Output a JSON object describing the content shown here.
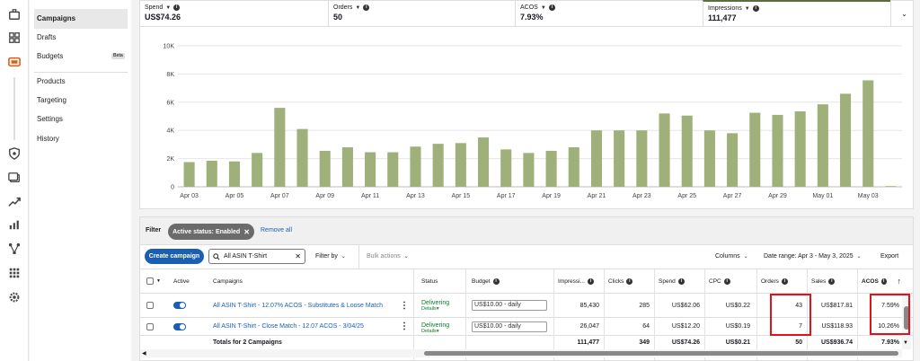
{
  "sidebar_rail": {
    "icons": [
      "briefcase-icon",
      "dashboard-icon",
      "campaign-manager-icon",
      "shield-icon",
      "media-icon",
      "growth-icon",
      "reports-icon",
      "network-icon",
      "apps-grid-icon",
      "settings-icon"
    ],
    "accent": "#e8590c"
  },
  "sidenav": {
    "items": [
      {
        "label": "Campaigns",
        "active": true
      },
      {
        "label": "Drafts"
      },
      {
        "label": "Budgets",
        "badge": "Beta"
      },
      {
        "label": "Products"
      },
      {
        "label": "Targeting"
      },
      {
        "label": "Settings"
      },
      {
        "label": "History"
      }
    ]
  },
  "metrics": [
    {
      "label": "Spend",
      "value": "US$74.26"
    },
    {
      "label": "Orders",
      "value": "50"
    },
    {
      "label": "ACOS",
      "value": "7.93%"
    },
    {
      "label": "Impressions",
      "value": "111,477",
      "selected": true
    }
  ],
  "chart_data": {
    "type": "bar",
    "color": "#9fb07a",
    "ylim": [
      0,
      10000
    ],
    "y_ticks": [
      0,
      2000,
      4000,
      6000,
      8000,
      10000
    ],
    "y_tick_labels": [
      "0",
      "2K",
      "4K",
      "6K",
      "8K",
      "10K"
    ],
    "categories": [
      "Apr 03",
      "Apr 04",
      "Apr 05",
      "Apr 06",
      "Apr 07",
      "Apr 08",
      "Apr 09",
      "Apr 10",
      "Apr 11",
      "Apr 12",
      "Apr 13",
      "Apr 14",
      "Apr 15",
      "Apr 16",
      "Apr 17",
      "Apr 18",
      "Apr 19",
      "Apr 20",
      "Apr 21",
      "Apr 22",
      "Apr 23",
      "Apr 24",
      "Apr 25",
      "Apr 26",
      "Apr 27",
      "Apr 28",
      "Apr 29",
      "Apr 30",
      "May 01",
      "May 02",
      "May 03"
    ],
    "x_tick_labels": [
      "Apr 03",
      "",
      "Apr 05",
      "",
      "Apr 07",
      "",
      "Apr 09",
      "",
      "Apr 11",
      "",
      "Apr 13",
      "",
      "Apr 15",
      "",
      "Apr 17",
      "",
      "Apr 19",
      "",
      "Apr 21",
      "",
      "Apr 23",
      "",
      "Apr 25",
      "",
      "Apr 27",
      "",
      "Apr 29",
      "",
      "May 01",
      "",
      "May 03"
    ],
    "values": [
      1750,
      1850,
      1800,
      2400,
      5600,
      4100,
      2550,
      2800,
      2450,
      2450,
      2850,
      3050,
      3100,
      3500,
      2650,
      2400,
      2550,
      2800,
      4000,
      4000,
      4000,
      5200,
      5050,
      4000,
      3800,
      5250,
      5100,
      5350,
      5850,
      6600,
      7550,
      50
    ],
    "grid": true
  },
  "filter": {
    "label": "Filter",
    "chip": "Active status: Enabled",
    "remove_all": "Remove all"
  },
  "toolbar": {
    "create": "Create campaign",
    "search_value": "All ASIN T-Shirt",
    "filter_by": "Filter by",
    "bulk_actions": "Bulk actions",
    "columns": "Columns",
    "date_range": "Date range: Apr 3 - May 3, 2025",
    "export": "Export"
  },
  "table": {
    "headers": {
      "active": "Active",
      "campaigns": "Campaigns",
      "status": "Status",
      "budget": "Budget",
      "impressions": "Impressi...",
      "clicks": "Clicks",
      "spend": "Spend",
      "cpc": "CPC",
      "orders": "Orders",
      "sales": "Sales",
      "acos": "ACOS"
    },
    "rows": [
      {
        "campaign": "All ASIN T-Shirt - 12.07% ACOS - Substitutes & Loose Match",
        "status": "Delivering",
        "details": "Details",
        "budget": "US$10.00 - daily",
        "impressions": "85,430",
        "clicks": "285",
        "spend": "US$62.06",
        "cpc": "US$0.22",
        "orders": "43",
        "sales": "US$817.81",
        "acos": "7.59%"
      },
      {
        "campaign": "All ASIN T-Shirt - Close Match - 12.07 ACOS - 3/04/25",
        "status": "Delivering",
        "details": "Details",
        "budget": "US$10.00 - daily",
        "impressions": "26,047",
        "clicks": "64",
        "spend": "US$12.20",
        "cpc": "US$0.19",
        "orders": "7",
        "sales": "US$118.93",
        "acos": "10.26%"
      }
    ],
    "totals": {
      "label": "Totals for 2 Campaigns",
      "impressions": "111,477",
      "clicks": "349",
      "spend": "US$74.26",
      "cpc": "US$0.21",
      "orders": "50",
      "sales": "US$936.74",
      "acos": "7.93%"
    }
  }
}
